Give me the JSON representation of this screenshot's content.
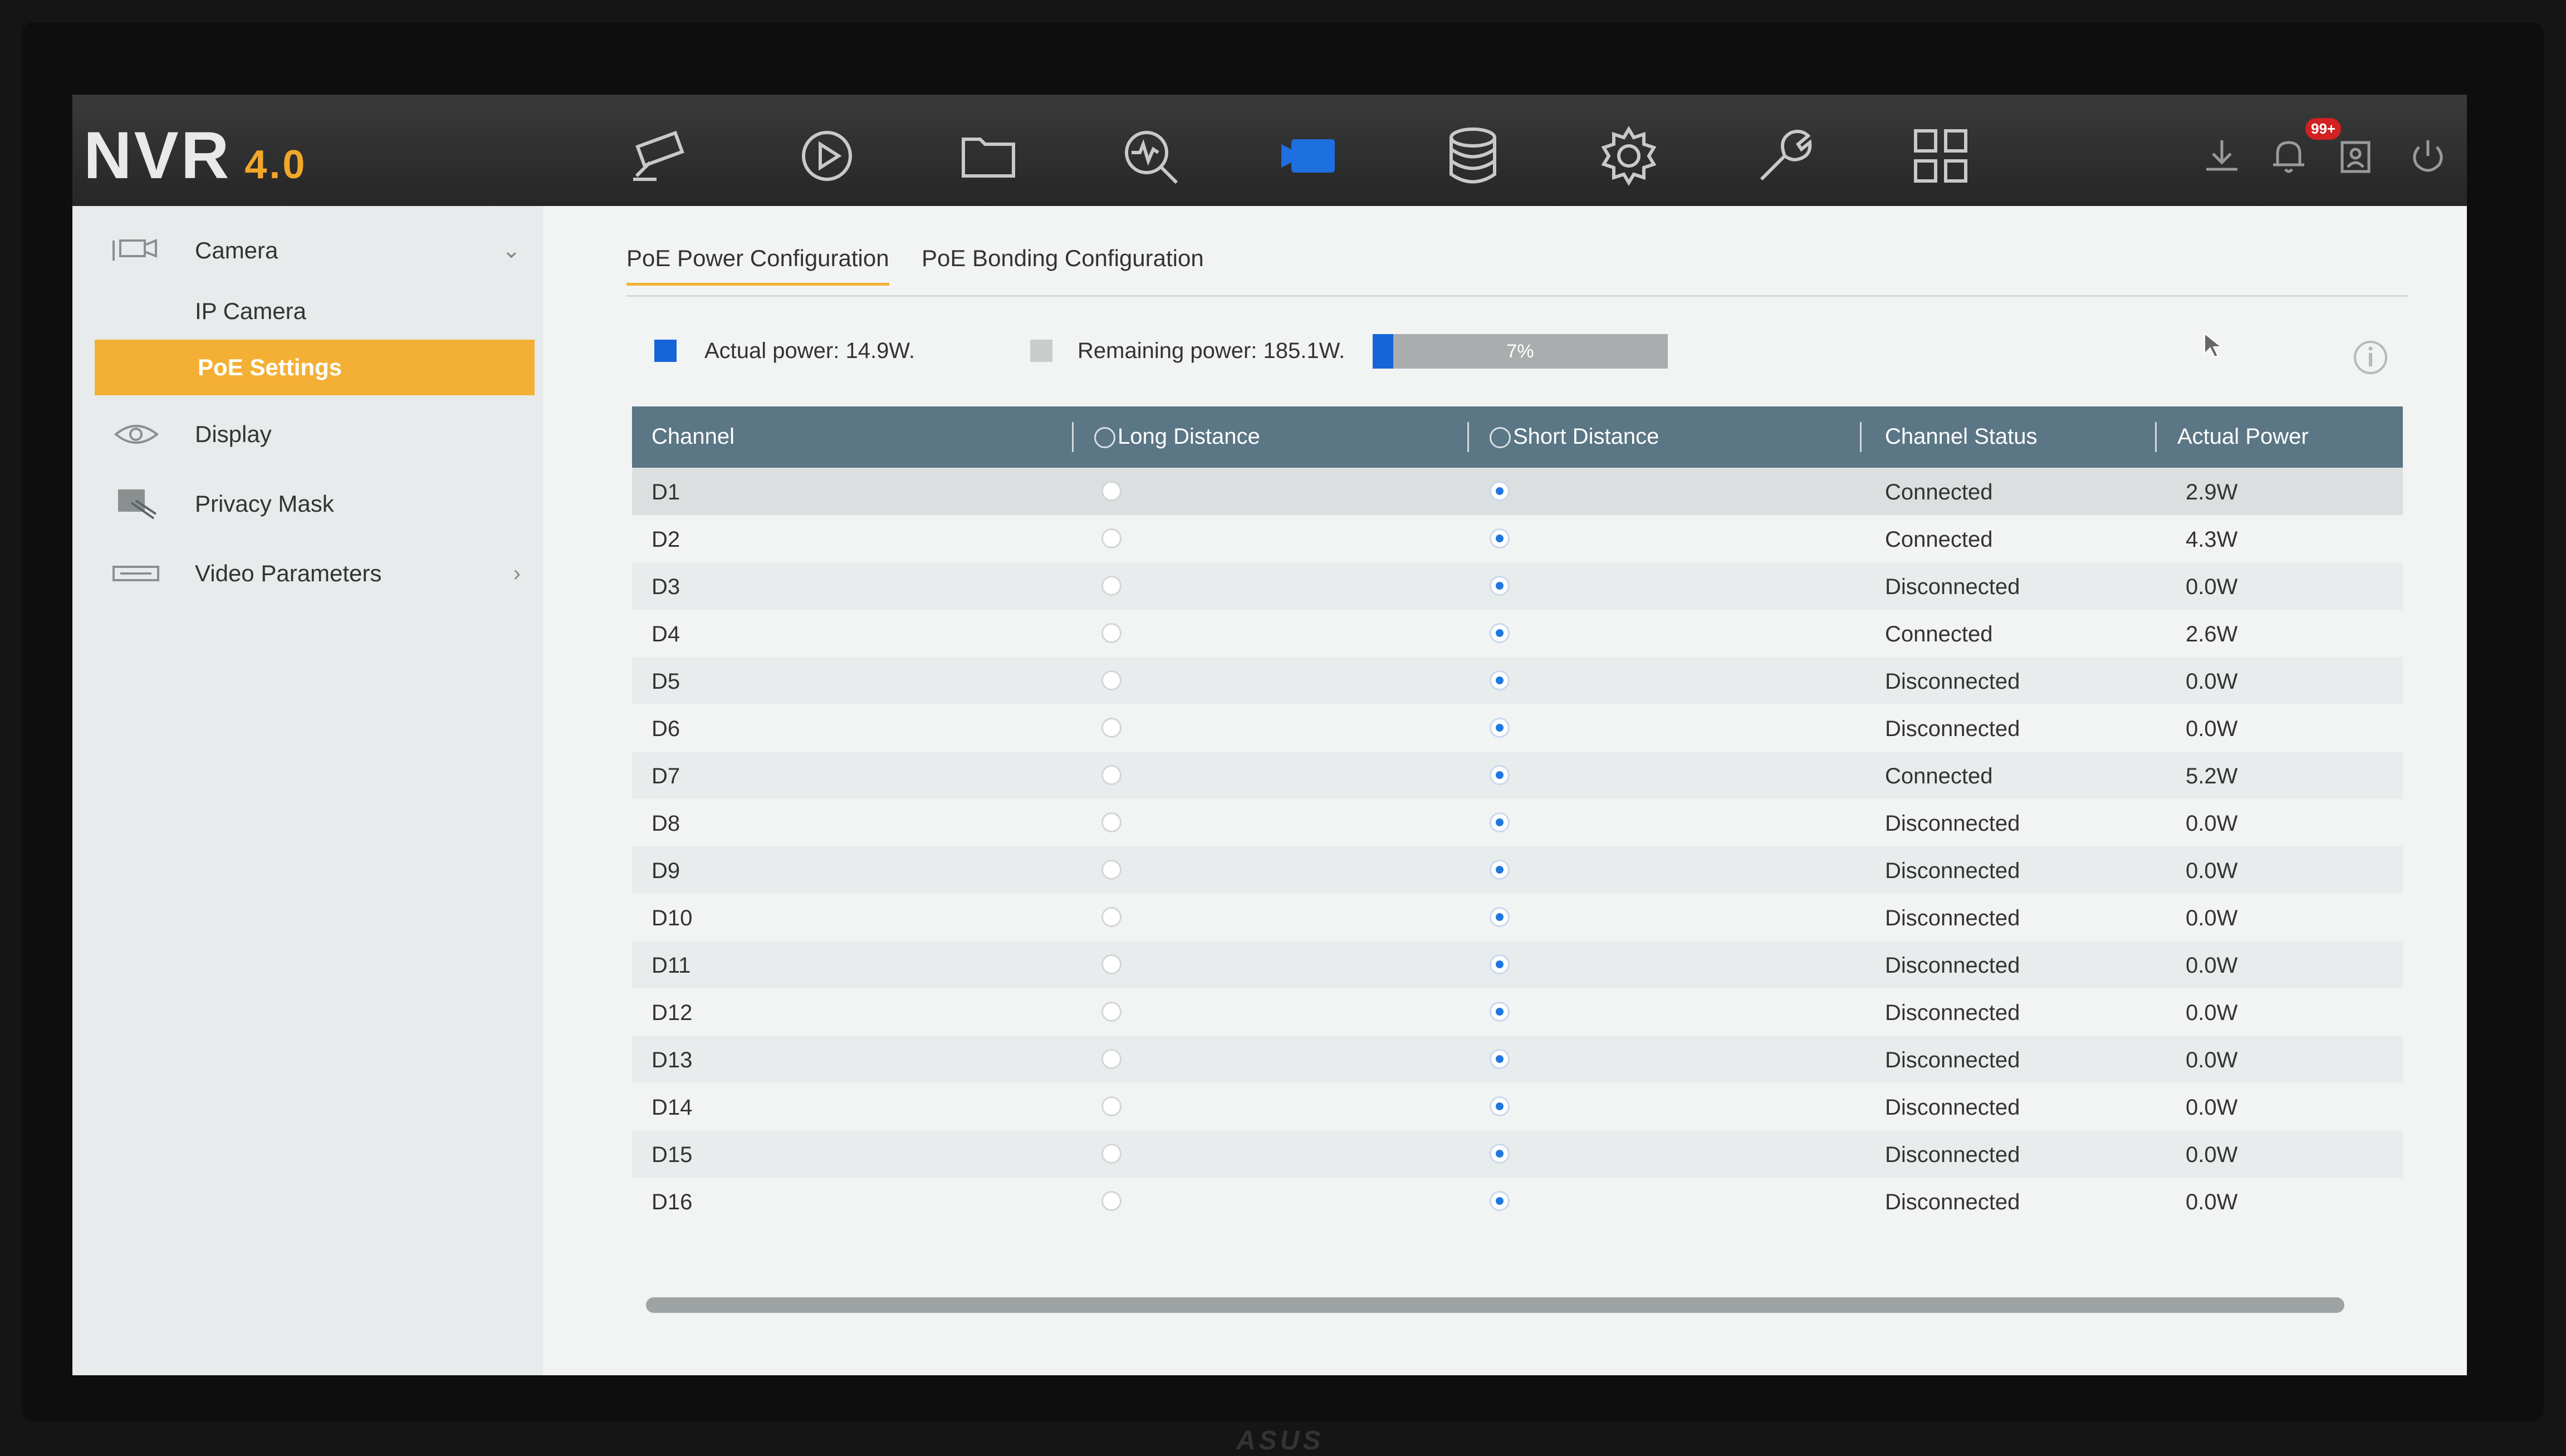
{
  "app": {
    "logo": "NVR",
    "version": "4.0"
  },
  "topnav": {
    "icons": [
      "live-view-icon",
      "playback-icon",
      "file-icon",
      "search-icon",
      "camera-icon",
      "storage-icon",
      "settings-icon",
      "maintenance-icon",
      "apps-icon"
    ],
    "active": "camera-icon",
    "notification_badge": "99+"
  },
  "sidebar": {
    "camera": "Camera",
    "ip_camera": "IP Camera",
    "poe_settings": "PoE Settings",
    "display": "Display",
    "privacy_mask": "Privacy Mask",
    "video_parameters": "Video Parameters"
  },
  "tabs": {
    "poe_power": "PoE Power Configuration",
    "poe_bonding": "PoE Bonding Configuration"
  },
  "power": {
    "actual_label": "Actual power: 14.9W.",
    "remaining_label": "Remaining power: 185.1W.",
    "usage_percent": 7,
    "usage_text": "7%"
  },
  "table": {
    "headers": {
      "channel": "Channel",
      "long": "Long Distance",
      "short": "Short Distance",
      "status": "Channel Status",
      "power": "Actual Power"
    },
    "rows": [
      {
        "channel": "D1",
        "mode": "short",
        "status": "Connected",
        "power": "2.9W"
      },
      {
        "channel": "D2",
        "mode": "short",
        "status": "Connected",
        "power": "4.3W"
      },
      {
        "channel": "D3",
        "mode": "short",
        "status": "Disconnected",
        "power": "0.0W"
      },
      {
        "channel": "D4",
        "mode": "short",
        "status": "Connected",
        "power": "2.6W"
      },
      {
        "channel": "D5",
        "mode": "short",
        "status": "Disconnected",
        "power": "0.0W"
      },
      {
        "channel": "D6",
        "mode": "short",
        "status": "Disconnected",
        "power": "0.0W"
      },
      {
        "channel": "D7",
        "mode": "short",
        "status": "Connected",
        "power": "5.2W"
      },
      {
        "channel": "D8",
        "mode": "short",
        "status": "Disconnected",
        "power": "0.0W"
      },
      {
        "channel": "D9",
        "mode": "short",
        "status": "Disconnected",
        "power": "0.0W"
      },
      {
        "channel": "D10",
        "mode": "short",
        "status": "Disconnected",
        "power": "0.0W"
      },
      {
        "channel": "D11",
        "mode": "short",
        "status": "Disconnected",
        "power": "0.0W"
      },
      {
        "channel": "D12",
        "mode": "short",
        "status": "Disconnected",
        "power": "0.0W"
      },
      {
        "channel": "D13",
        "mode": "short",
        "status": "Disconnected",
        "power": "0.0W"
      },
      {
        "channel": "D14",
        "mode": "short",
        "status": "Disconnected",
        "power": "0.0W"
      },
      {
        "channel": "D15",
        "mode": "short",
        "status": "Disconnected",
        "power": "0.0W"
      },
      {
        "channel": "D16",
        "mode": "short",
        "status": "Disconnected",
        "power": "0.0W"
      }
    ]
  },
  "colors": {
    "accent": "#f4b035",
    "header": "#5b7685",
    "active_icon": "#1e6fe0",
    "progress": "#1565d8"
  },
  "monitor_brand": "ASUS"
}
